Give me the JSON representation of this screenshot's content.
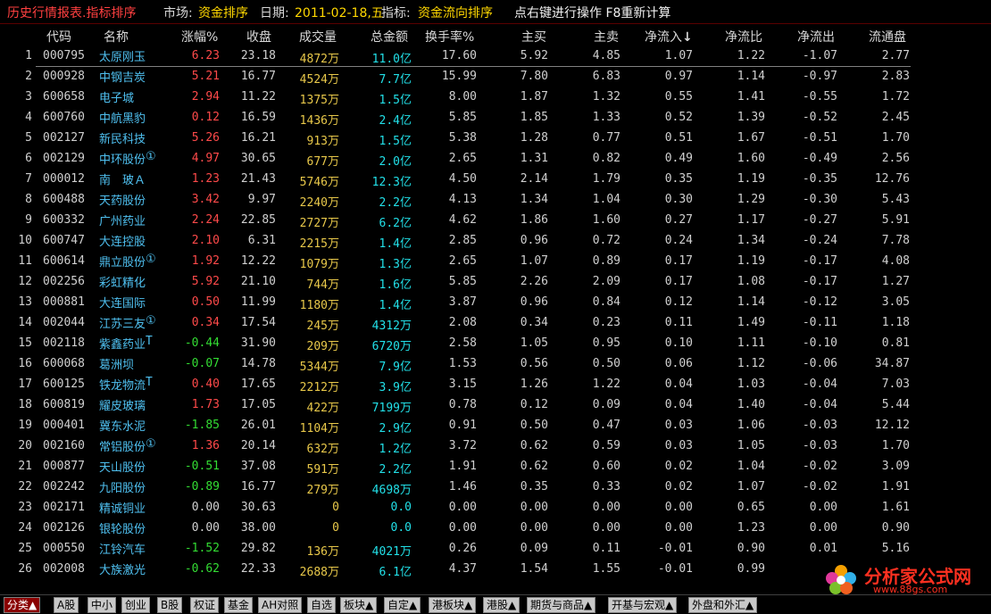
{
  "titlebar": {
    "title": "历史行情报表.指标排序",
    "market_label": "市场:",
    "market_value": "资金排序",
    "date_label": "日期:",
    "date_value": "2011-02-18,五",
    "indicator_label": "指标:",
    "indicator_value": "资金流向排序",
    "hint": "点右键进行操作 F8重新计算"
  },
  "columns": [
    "代码",
    "名称",
    "涨幅%",
    "收盘",
    "成交量",
    "总金额",
    "换手率%",
    "主买",
    "主卖",
    "净流入",
    "净流比",
    "净流出",
    "流通盘"
  ],
  "sort_arrow": "↓",
  "rows": [
    {
      "i": "1",
      "code": "000795",
      "name": "太原刚玉",
      "mark": "",
      "chg": "6.23",
      "dir": "up",
      "close": "23.18",
      "vol": "4872",
      "vunit": "万",
      "amt": "11.0",
      "aunit": "亿",
      "turn": "17.60",
      "buy": "5.92",
      "sell": "4.85",
      "netin": "1.07",
      "ratio": "1.22",
      "netout": "-1.07",
      "float": "2.77"
    },
    {
      "i": "2",
      "code": "000928",
      "name": "中钢吉炭",
      "mark": "",
      "chg": "5.21",
      "dir": "up",
      "close": "16.77",
      "vol": "4524",
      "vunit": "万",
      "amt": "7.7",
      "aunit": "亿",
      "turn": "15.99",
      "buy": "7.80",
      "sell": "6.83",
      "netin": "0.97",
      "ratio": "1.14",
      "netout": "-0.97",
      "float": "2.83"
    },
    {
      "i": "3",
      "code": "600658",
      "name": "电子城",
      "mark": "",
      "chg": "2.94",
      "dir": "up",
      "close": "11.22",
      "vol": "1375",
      "vunit": "万",
      "amt": "1.5",
      "aunit": "亿",
      "turn": "8.00",
      "buy": "1.87",
      "sell": "1.32",
      "netin": "0.55",
      "ratio": "1.41",
      "netout": "-0.55",
      "float": "1.72"
    },
    {
      "i": "4",
      "code": "600760",
      "name": "中航黑豹",
      "mark": "",
      "chg": "0.12",
      "dir": "up",
      "close": "16.59",
      "vol": "1436",
      "vunit": "万",
      "amt": "2.4",
      "aunit": "亿",
      "turn": "5.85",
      "buy": "1.85",
      "sell": "1.33",
      "netin": "0.52",
      "ratio": "1.39",
      "netout": "-0.52",
      "float": "2.45"
    },
    {
      "i": "5",
      "code": "002127",
      "name": "新民科技",
      "mark": "",
      "chg": "5.26",
      "dir": "up",
      "close": "16.21",
      "vol": "913",
      "vunit": "万",
      "amt": "1.5",
      "aunit": "亿",
      "turn": "5.38",
      "buy": "1.28",
      "sell": "0.77",
      "netin": "0.51",
      "ratio": "1.67",
      "netout": "-0.51",
      "float": "1.70"
    },
    {
      "i": "6",
      "code": "002129",
      "name": "中环股份",
      "mark": "①",
      "chg": "4.97",
      "dir": "up",
      "close": "30.65",
      "vol": "677",
      "vunit": "万",
      "amt": "2.0",
      "aunit": "亿",
      "turn": "2.65",
      "buy": "1.31",
      "sell": "0.82",
      "netin": "0.49",
      "ratio": "1.60",
      "netout": "-0.49",
      "float": "2.56"
    },
    {
      "i": "7",
      "code": "000012",
      "name": "南　玻Ａ",
      "mark": "",
      "chg": "1.23",
      "dir": "up",
      "close": "21.43",
      "vol": "5746",
      "vunit": "万",
      "amt": "12.3",
      "aunit": "亿",
      "turn": "4.50",
      "buy": "2.14",
      "sell": "1.79",
      "netin": "0.35",
      "ratio": "1.19",
      "netout": "-0.35",
      "float": "12.76"
    },
    {
      "i": "8",
      "code": "600488",
      "name": "天药股份",
      "mark": "",
      "chg": "3.42",
      "dir": "up",
      "close": "9.97",
      "vol": "2240",
      "vunit": "万",
      "amt": "2.2",
      "aunit": "亿",
      "turn": "4.13",
      "buy": "1.34",
      "sell": "1.04",
      "netin": "0.30",
      "ratio": "1.29",
      "netout": "-0.30",
      "float": "5.43"
    },
    {
      "i": "9",
      "code": "600332",
      "name": "广州药业",
      "mark": "",
      "chg": "2.24",
      "dir": "up",
      "close": "22.85",
      "vol": "2727",
      "vunit": "万",
      "amt": "6.2",
      "aunit": "亿",
      "turn": "4.62",
      "buy": "1.86",
      "sell": "1.60",
      "netin": "0.27",
      "ratio": "1.17",
      "netout": "-0.27",
      "float": "5.91"
    },
    {
      "i": "10",
      "code": "600747",
      "name": "大连控股",
      "mark": "",
      "chg": "2.10",
      "dir": "up",
      "close": "6.31",
      "vol": "2215",
      "vunit": "万",
      "amt": "1.4",
      "aunit": "亿",
      "turn": "2.85",
      "buy": "0.96",
      "sell": "0.72",
      "netin": "0.24",
      "ratio": "1.34",
      "netout": "-0.24",
      "float": "7.78"
    },
    {
      "i": "11",
      "code": "600614",
      "name": "鼎立股份",
      "mark": "①",
      "chg": "1.92",
      "dir": "up",
      "close": "12.22",
      "vol": "1079",
      "vunit": "万",
      "amt": "1.3",
      "aunit": "亿",
      "turn": "2.65",
      "buy": "1.07",
      "sell": "0.89",
      "netin": "0.17",
      "ratio": "1.19",
      "netout": "-0.17",
      "float": "4.08"
    },
    {
      "i": "12",
      "code": "002256",
      "name": "彩虹精化",
      "mark": "",
      "chg": "5.92",
      "dir": "up",
      "close": "21.10",
      "vol": "744",
      "vunit": "万",
      "amt": "1.6",
      "aunit": "亿",
      "turn": "5.85",
      "buy": "2.26",
      "sell": "2.09",
      "netin": "0.17",
      "ratio": "1.08",
      "netout": "-0.17",
      "float": "1.27"
    },
    {
      "i": "13",
      "code": "000881",
      "name": "大连国际",
      "mark": "",
      "chg": "0.50",
      "dir": "up",
      "close": "11.99",
      "vol": "1180",
      "vunit": "万",
      "amt": "1.4",
      "aunit": "亿",
      "turn": "3.87",
      "buy": "0.96",
      "sell": "0.84",
      "netin": "0.12",
      "ratio": "1.14",
      "netout": "-0.12",
      "float": "3.05"
    },
    {
      "i": "14",
      "code": "002044",
      "name": "江苏三友",
      "mark": "①",
      "chg": "0.34",
      "dir": "up",
      "close": "17.54",
      "vol": "245",
      "vunit": "万",
      "amt": "4312",
      "aunit": "万",
      "turn": "2.08",
      "buy": "0.34",
      "sell": "0.23",
      "netin": "0.11",
      "ratio": "1.49",
      "netout": "-0.11",
      "float": "1.18"
    },
    {
      "i": "15",
      "code": "002118",
      "name": "紫鑫药业",
      "mark": "T",
      "chg": "-0.44",
      "dir": "dn",
      "close": "31.90",
      "vol": "209",
      "vunit": "万",
      "amt": "6720",
      "aunit": "万",
      "turn": "2.58",
      "buy": "1.05",
      "sell": "0.95",
      "netin": "0.10",
      "ratio": "1.11",
      "netout": "-0.10",
      "float": "0.81"
    },
    {
      "i": "16",
      "code": "600068",
      "name": "葛洲坝",
      "mark": "",
      "chg": "-0.07",
      "dir": "dn",
      "close": "14.78",
      "vol": "5344",
      "vunit": "万",
      "amt": "7.9",
      "aunit": "亿",
      "turn": "1.53",
      "buy": "0.56",
      "sell": "0.50",
      "netin": "0.06",
      "ratio": "1.12",
      "netout": "-0.06",
      "float": "34.87"
    },
    {
      "i": "17",
      "code": "600125",
      "name": "铁龙物流",
      "mark": "T",
      "chg": "0.40",
      "dir": "up",
      "close": "17.65",
      "vol": "2212",
      "vunit": "万",
      "amt": "3.9",
      "aunit": "亿",
      "turn": "3.15",
      "buy": "1.26",
      "sell": "1.22",
      "netin": "0.04",
      "ratio": "1.03",
      "netout": "-0.04",
      "float": "7.03"
    },
    {
      "i": "18",
      "code": "600819",
      "name": "耀皮玻璃",
      "mark": "",
      "chg": "1.73",
      "dir": "up",
      "close": "17.05",
      "vol": "422",
      "vunit": "万",
      "amt": "7199",
      "aunit": "万",
      "turn": "0.78",
      "buy": "0.12",
      "sell": "0.09",
      "netin": "0.04",
      "ratio": "1.40",
      "netout": "-0.04",
      "float": "5.44"
    },
    {
      "i": "19",
      "code": "000401",
      "name": "冀东水泥",
      "mark": "",
      "chg": "-1.85",
      "dir": "dn",
      "close": "26.01",
      "vol": "1104",
      "vunit": "万",
      "amt": "2.9",
      "aunit": "亿",
      "turn": "0.91",
      "buy": "0.50",
      "sell": "0.47",
      "netin": "0.03",
      "ratio": "1.06",
      "netout": "-0.03",
      "float": "12.12"
    },
    {
      "i": "20",
      "code": "002160",
      "name": "常铝股份",
      "mark": "①",
      "chg": "1.36",
      "dir": "up",
      "close": "20.14",
      "vol": "632",
      "vunit": "万",
      "amt": "1.2",
      "aunit": "亿",
      "turn": "3.72",
      "buy": "0.62",
      "sell": "0.59",
      "netin": "0.03",
      "ratio": "1.05",
      "netout": "-0.03",
      "float": "1.70"
    },
    {
      "i": "21",
      "code": "000877",
      "name": "天山股份",
      "mark": "",
      "chg": "-0.51",
      "dir": "dn",
      "close": "37.08",
      "vol": "591",
      "vunit": "万",
      "amt": "2.2",
      "aunit": "亿",
      "turn": "1.91",
      "buy": "0.62",
      "sell": "0.60",
      "netin": "0.02",
      "ratio": "1.04",
      "netout": "-0.02",
      "float": "3.09"
    },
    {
      "i": "22",
      "code": "002242",
      "name": "九阳股份",
      "mark": "",
      "chg": "-0.89",
      "dir": "dn",
      "close": "16.77",
      "vol": "279",
      "vunit": "万",
      "amt": "4698",
      "aunit": "万",
      "turn": "1.46",
      "buy": "0.35",
      "sell": "0.33",
      "netin": "0.02",
      "ratio": "1.07",
      "netout": "-0.02",
      "float": "1.91"
    },
    {
      "i": "23",
      "code": "002171",
      "name": "精诚铜业",
      "mark": "",
      "chg": "0.00",
      "dir": "fl",
      "close": "30.63",
      "vol": "0",
      "vunit": "",
      "amt": "0.0",
      "aunit": "",
      "turn": "0.00",
      "buy": "0.00",
      "sell": "0.00",
      "netin": "0.00",
      "ratio": "0.65",
      "netout": "0.00",
      "float": "1.61"
    },
    {
      "i": "24",
      "code": "002126",
      "name": "银轮股份",
      "mark": "",
      "chg": "0.00",
      "dir": "fl",
      "close": "38.00",
      "vol": "0",
      "vunit": "",
      "amt": "0.0",
      "aunit": "",
      "turn": "0.00",
      "buy": "0.00",
      "sell": "0.00",
      "netin": "0.00",
      "ratio": "1.23",
      "netout": "0.00",
      "float": "0.90"
    },
    {
      "i": "25",
      "code": "000550",
      "name": "江铃汽车",
      "mark": "",
      "chg": "-1.52",
      "dir": "dn",
      "close": "29.82",
      "vol": "136",
      "vunit": "万",
      "amt": "4021",
      "aunit": "万",
      "turn": "0.26",
      "buy": "0.09",
      "sell": "0.11",
      "netin": "-0.01",
      "ratio": "0.90",
      "netout": "0.01",
      "float": "5.16"
    },
    {
      "i": "26",
      "code": "002008",
      "name": "大族激光",
      "mark": "",
      "chg": "-0.62",
      "dir": "dn",
      "close": "22.33",
      "vol": "2688",
      "vunit": "万",
      "amt": "6.1",
      "aunit": "亿",
      "turn": "4.37",
      "buy": "1.54",
      "sell": "1.55",
      "netin": "-0.01",
      "ratio": "0.99",
      "netout": "",
      "float": ""
    }
  ],
  "bottom_tabs": [
    "分类▲",
    "A股",
    "中小",
    "创业",
    "B股",
    "权证",
    "基金",
    "AH对照",
    "自选",
    "板块▲",
    "自定▲",
    "港板块▲",
    "港股▲",
    "期货与商品▲",
    "开基与宏观▲",
    "外盘和外汇▲"
  ],
  "logo": {
    "title": "分析家公式网",
    "url": "www.88gs.com"
  }
}
